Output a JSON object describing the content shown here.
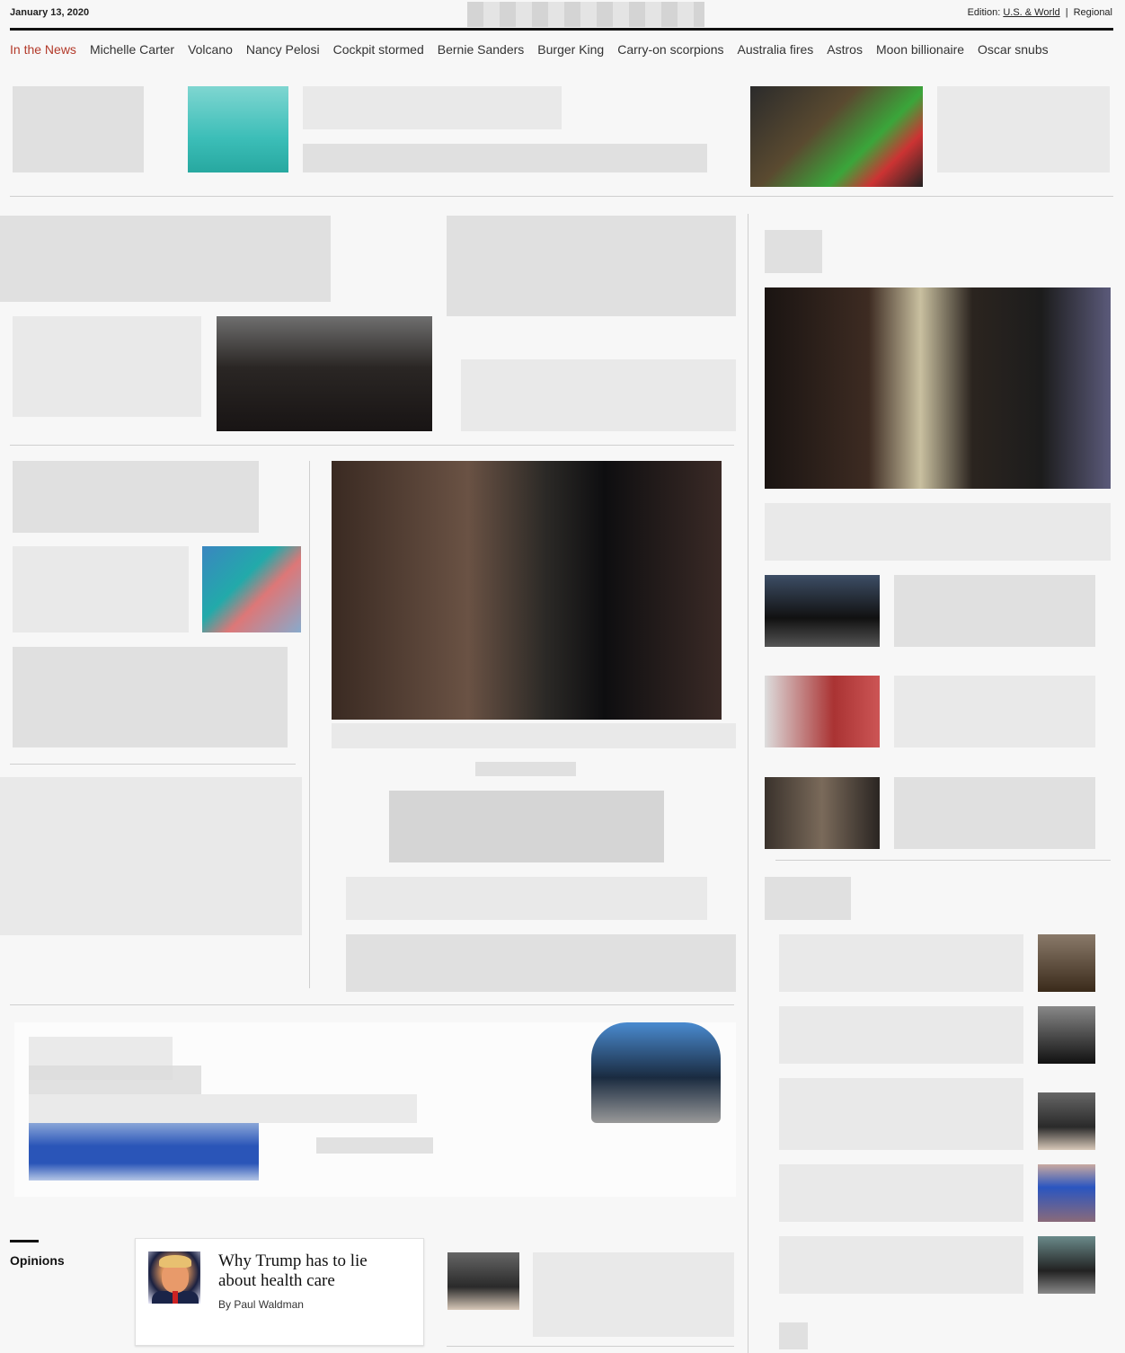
{
  "header": {
    "date": "January 13, 2020",
    "edition_label": "Edition:",
    "edition_current": "U.S. & World",
    "edition_separator": "|",
    "edition_alt": "Regional"
  },
  "nav": {
    "items": [
      "In the News",
      "Michelle Carter",
      "Volcano",
      "Nancy Pelosi",
      "Cockpit stormed",
      "Bernie Sanders",
      "Burger King",
      "Carry-on scorpions",
      "Australia fires",
      "Astros",
      "Moon billionaire",
      "Oscar snubs"
    ]
  },
  "opinions": {
    "section_label": "Opinions",
    "card": {
      "headline": "Why Trump has to lie about health care",
      "byline_prefix": "By",
      "author": "Paul Waldman"
    }
  },
  "colors": {
    "accent_red": "#b33a2a",
    "rule": "#111111",
    "divider": "#cfcfcf"
  }
}
